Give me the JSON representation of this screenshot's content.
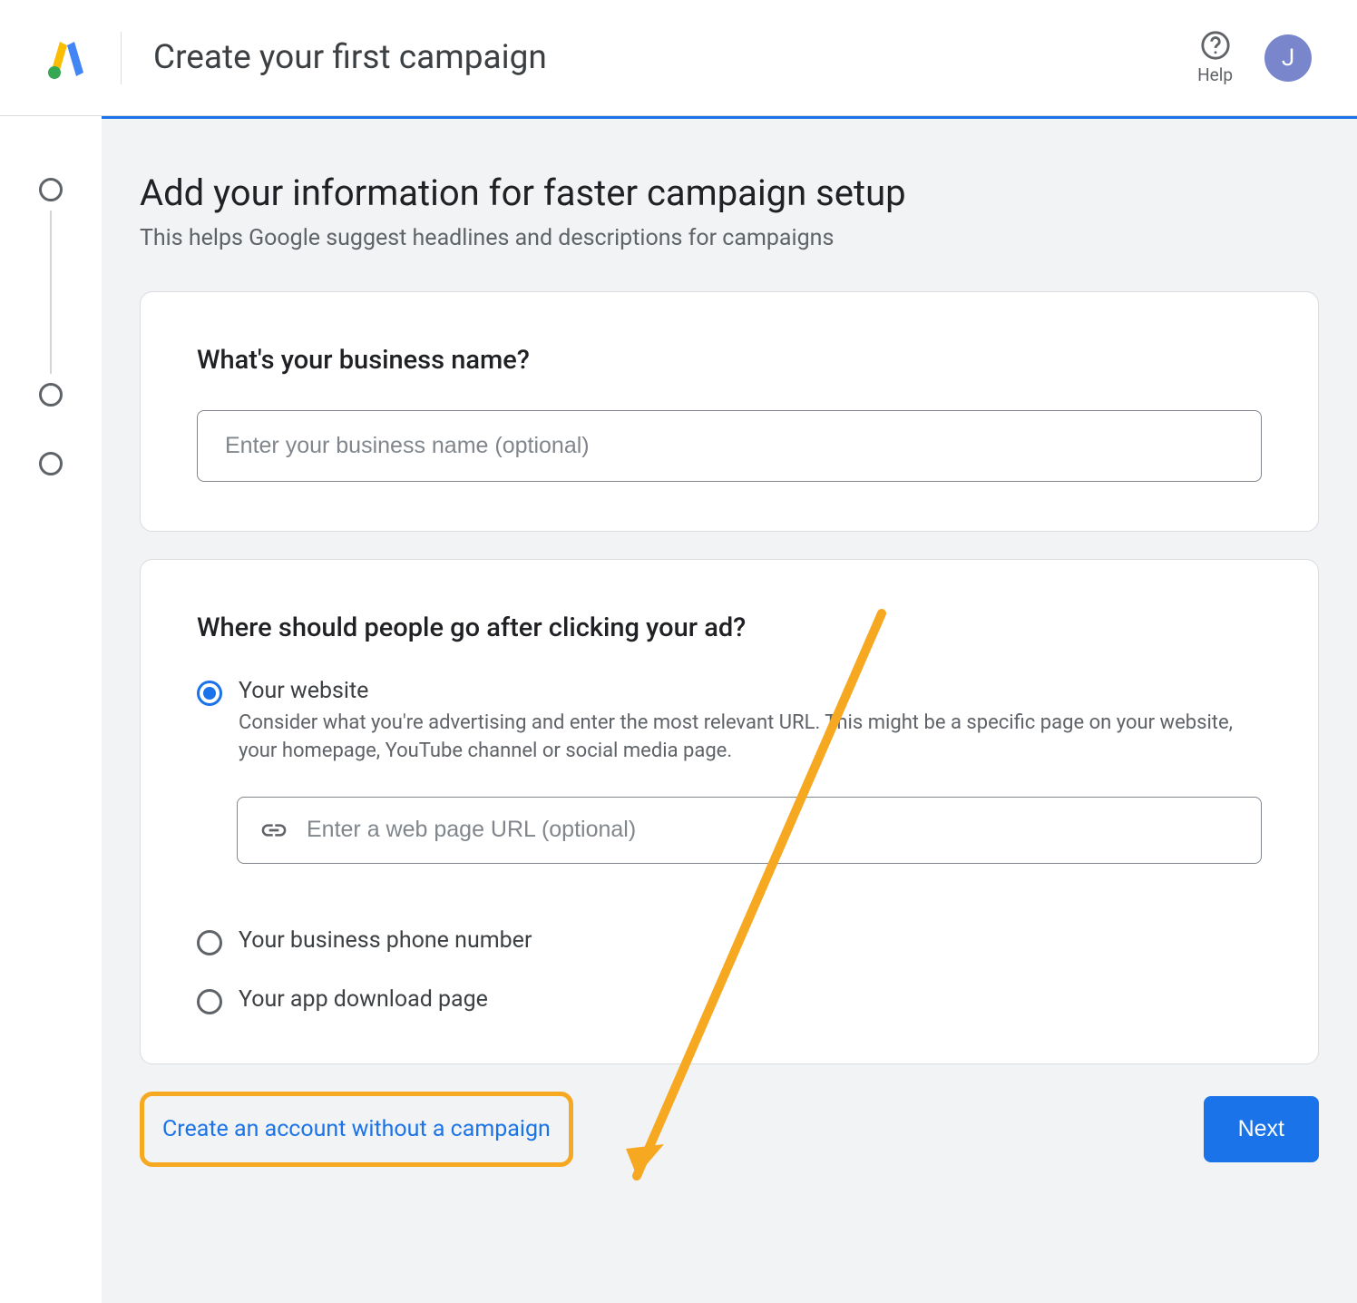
{
  "header": {
    "title": "Create your first campaign",
    "help_label": "Help",
    "avatar_initial": "J"
  },
  "main": {
    "heading": "Add your information for faster campaign setup",
    "subheading": "This helps Google suggest headlines and descriptions for campaigns"
  },
  "business_card": {
    "title": "What's your business name?",
    "placeholder": "Enter your business name (optional)"
  },
  "destination_card": {
    "title": "Where should people go after clicking your ad?",
    "options": [
      {
        "label": "Your website",
        "desc": "Consider what you're advertising and enter the most relevant URL. This might be a specific page on your website, your homepage, YouTube channel or social media page.",
        "selected": true
      },
      {
        "label": "Your business phone number",
        "selected": false
      },
      {
        "label": "Your app download page",
        "selected": false
      }
    ],
    "url_placeholder": "Enter a web page URL (optional)"
  },
  "footer": {
    "skip_link": "Create an account without a campaign",
    "next_label": "Next"
  }
}
